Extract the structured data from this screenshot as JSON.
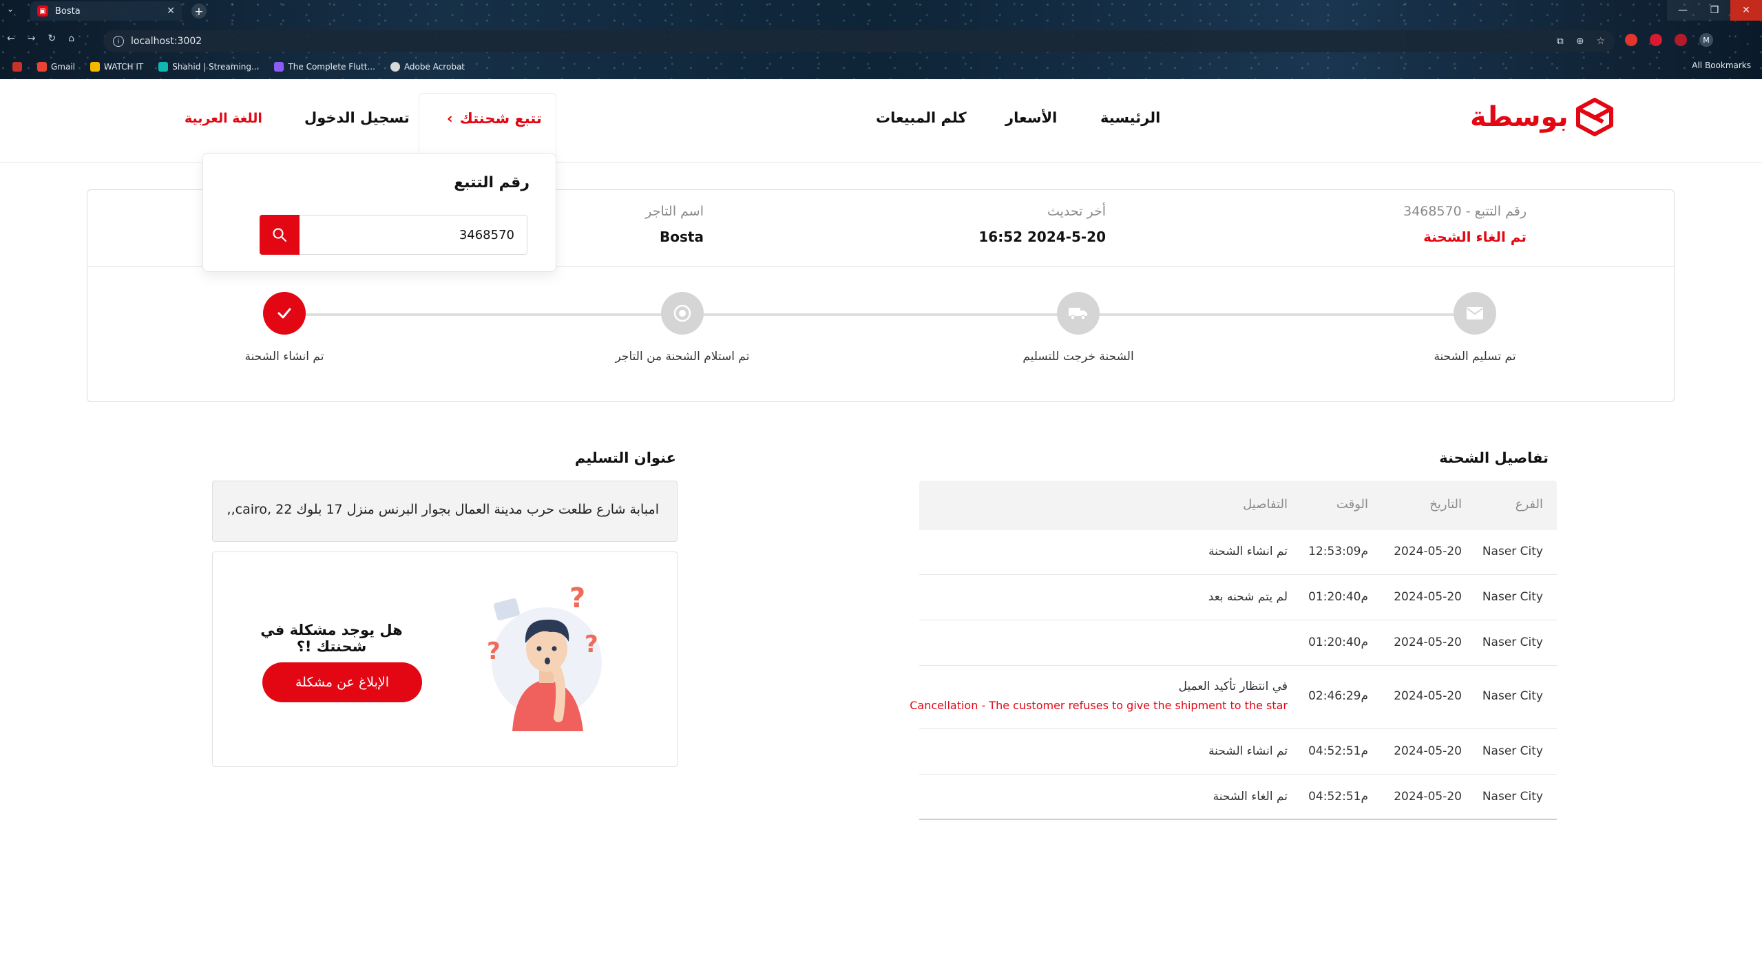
{
  "browser": {
    "tab_title": "Bosta",
    "url": "localhost:3002",
    "bookmarks": [
      {
        "label": "Gmail",
        "color": "#ea4335"
      },
      {
        "label": "WATCH IT",
        "color": "#f5b800"
      },
      {
        "label": "Shahid | Streaming...",
        "color": "#0fb9b1"
      },
      {
        "label": "The Complete Flutt...",
        "color": "#8b5cf6"
      },
      {
        "label": "Adobe Acrobat",
        "color": "#d9d9d9"
      }
    ],
    "all_bookmarks": "All Bookmarks",
    "profile_initial": "M"
  },
  "header": {
    "logo_text": "بوسطة",
    "nav": {
      "home": "الرئيسية",
      "prices": "الأسعار",
      "sales": "كلم المبيعات",
      "track": "تتبع شحنتك",
      "login": "تسجيل الدخول",
      "language": "اللغة العربية"
    }
  },
  "tracking_dropdown": {
    "title": "رقم التتبع",
    "input_value": "3468570"
  },
  "status": {
    "tracking_label": "رقم التتبع - 3468570",
    "status_value": "تم الغاء الشحنة",
    "last_update_label": "أخر تحديث",
    "last_update_value": "16:52 2024-5-20",
    "merchant_label": "اسم التاجر",
    "merchant_value": "Bosta",
    "steps": [
      {
        "label": "تم انشاء الشحنة",
        "icon": "check-icon",
        "done": true
      },
      {
        "label": "تم استلام الشحنة من التاجر",
        "icon": "record-icon",
        "done": false
      },
      {
        "label": "الشحنة خرجت للتسليم",
        "icon": "truck-icon",
        "done": false
      },
      {
        "label": "تم تسليم الشحنة",
        "icon": "mail-icon",
        "done": false
      }
    ]
  },
  "details": {
    "title": "تفاصيل الشحنة",
    "headers": {
      "branch": "الفرع",
      "date": "التاريخ",
      "time": "الوقت",
      "details": "التفاصيل"
    },
    "rows": [
      {
        "branch": "Naser City",
        "date": "2024-05-20",
        "time": "12:53:09م",
        "details": "تم انشاء الشحنة",
        "reason": ""
      },
      {
        "branch": "Naser City",
        "date": "2024-05-20",
        "time": "01:20:40م",
        "details": "لم يتم شحنه بعد",
        "reason": ""
      },
      {
        "branch": "Naser City",
        "date": "2024-05-20",
        "time": "01:20:40م",
        "details": "",
        "reason": ""
      },
      {
        "branch": "Naser City",
        "date": "2024-05-20",
        "time": "02:46:29م",
        "details": "في انتظار تأكيد العميل",
        "reason": "Cancellation - The customer refuses to give the shipment to the star"
      },
      {
        "branch": "Naser City",
        "date": "2024-05-20",
        "time": "04:52:51م",
        "details": "تم انشاء الشحنة",
        "reason": ""
      },
      {
        "branch": "Naser City",
        "date": "2024-05-20",
        "time": "04:52:51م",
        "details": "تم الغاء الشحنة",
        "reason": ""
      }
    ]
  },
  "address": {
    "title": "عنوان التسليم",
    "text": "امبابة شارع طلعت حرب مدينة العمال بجوار البرنس منزل 17 بلوك 22 ,cairo,,"
  },
  "problem": {
    "question": "هل يوجد مشكلة في شحنتك !؟",
    "button": "الإبلاغ عن مشكلة"
  },
  "colors": {
    "brand": "#e30613",
    "step_inactive": "#d5d5d5"
  }
}
